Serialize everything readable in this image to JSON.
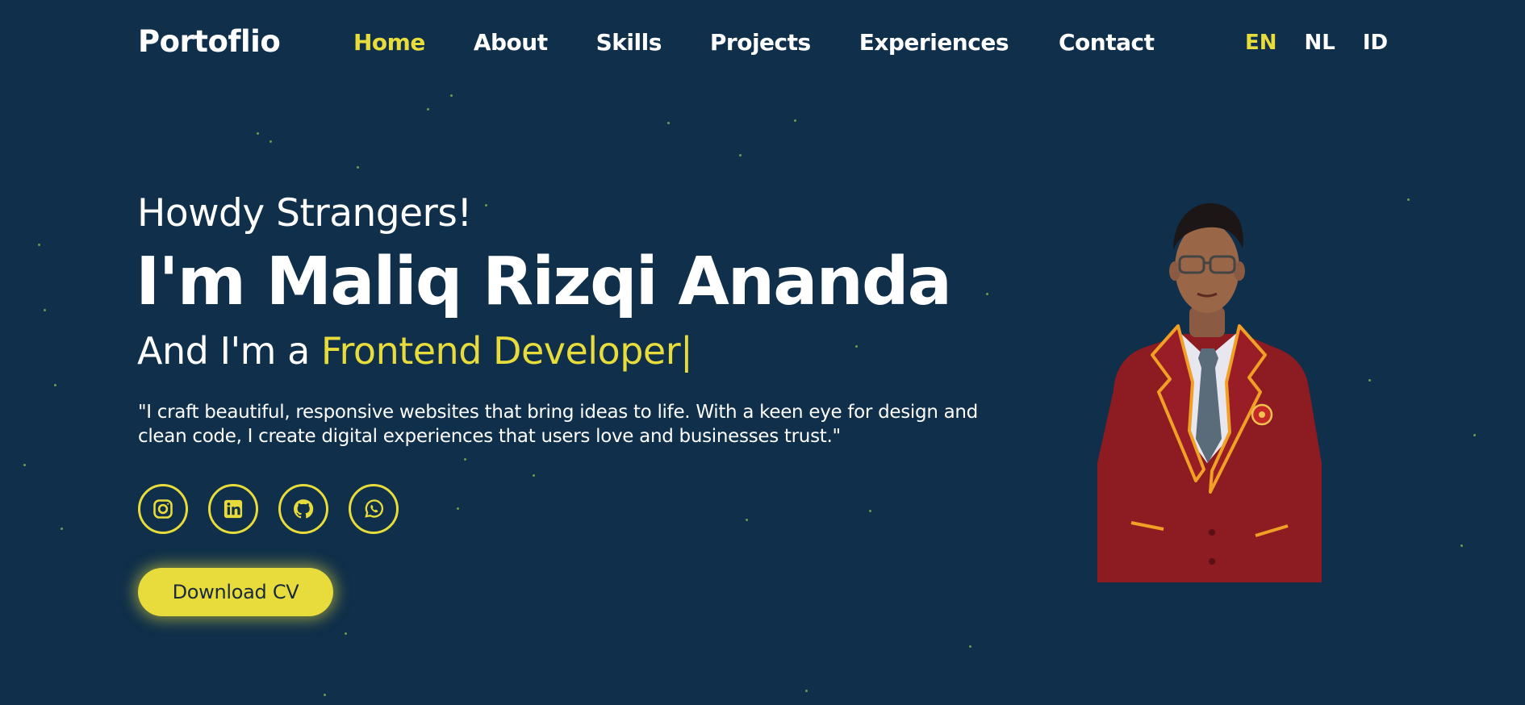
{
  "header": {
    "logo": "Portoflio",
    "nav": [
      {
        "label": "Home",
        "active": true
      },
      {
        "label": "About",
        "active": false
      },
      {
        "label": "Skills",
        "active": false
      },
      {
        "label": "Projects",
        "active": false
      },
      {
        "label": "Experiences",
        "active": false
      },
      {
        "label": "Contact",
        "active": false
      }
    ],
    "languages": [
      {
        "label": "EN",
        "active": true
      },
      {
        "label": "NL",
        "active": false
      },
      {
        "label": "ID",
        "active": false
      }
    ]
  },
  "hero": {
    "greeting": "Howdy Strangers!",
    "name": "I'm Maliq Rizqi Ananda",
    "role_prefix": "And I'm a ",
    "role_highlight": "Frontend Developer",
    "cursor": "|",
    "quote": "\"I craft beautiful, responsive websites that bring ideas to life. With a keen eye for design and clean code, I create digital experiences that users love and businesses trust.\"",
    "socials": [
      {
        "icon": "instagram-icon"
      },
      {
        "icon": "linkedin-icon"
      },
      {
        "icon": "github-icon"
      },
      {
        "icon": "whatsapp-icon"
      }
    ],
    "cv_button": "Download CV"
  },
  "colors": {
    "background": "#0f2f4a",
    "accent": "#e8dc3c",
    "text": "#ffffff",
    "star": "#8bc34a"
  }
}
